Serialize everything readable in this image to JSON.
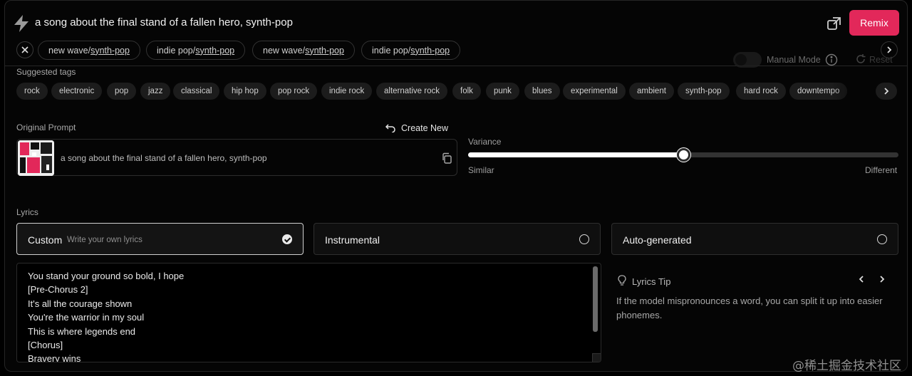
{
  "header": {
    "title": "a song about the final stand of a fallen hero, synth-pop",
    "remix_label": "Remix"
  },
  "style_chips": [
    {
      "prefix": "new wave/",
      "suffix": "synth-pop"
    },
    {
      "prefix": "indie pop/",
      "suffix": "synth-pop"
    },
    {
      "prefix": "new wave/",
      "suffix": "synth-pop"
    },
    {
      "prefix": "indie pop/",
      "suffix": "synth-pop"
    }
  ],
  "manual_mode": {
    "label": "Manual Mode",
    "enabled": false
  },
  "refresh_label": "Reset",
  "suggested": {
    "label": "Suggested tags",
    "tags": [
      "rock",
      "electronic",
      "pop",
      "jazz",
      "classical",
      "hip hop",
      "pop rock",
      "indie rock",
      "alternative rock",
      "folk",
      "punk",
      "blues",
      "experimental",
      "ambient",
      "synth-pop",
      "hard rock",
      "downtempo"
    ]
  },
  "original_prompt": {
    "label": "Original Prompt",
    "create_new_label": "Create New",
    "text": "a song about the final stand of a fallen hero, synth-pop"
  },
  "variance": {
    "label": "Variance",
    "min_label": "Similar",
    "max_label": "Different",
    "value": 0.5
  },
  "lyrics": {
    "label": "Lyrics",
    "modes": [
      {
        "title": "Custom",
        "subtitle": "Write your own lyrics",
        "selected": true
      },
      {
        "title": "Instrumental",
        "subtitle": "",
        "selected": false
      },
      {
        "title": "Auto-generated",
        "subtitle": "",
        "selected": false
      }
    ],
    "lines": [
      "You stand your ground so bold, I hope",
      "[Pre-Chorus 2]",
      "It's all the courage shown",
      "You're the warrior in my soul",
      "This is where legends end",
      "[Chorus]",
      "Bravery wins"
    ]
  },
  "tip": {
    "title": "Lyrics Tip",
    "text": "If the model mispronounces a word, you can split it up into easier phonemes."
  },
  "watermark": "@稀土掘金技术社区",
  "colors": {
    "accent": "#e2285a",
    "background": "#050505"
  }
}
